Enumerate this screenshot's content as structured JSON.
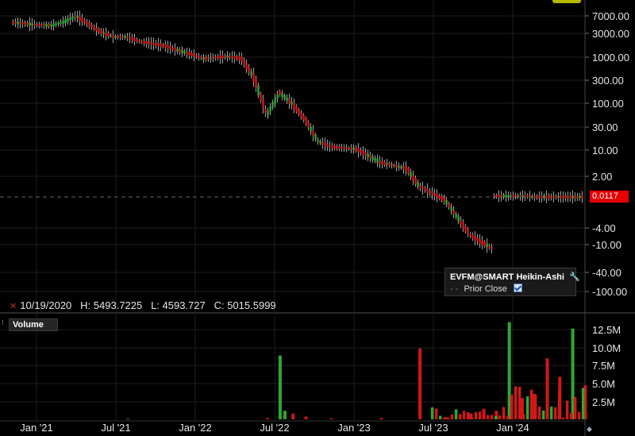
{
  "instrument": {
    "symbol_title": "EVFM@SMART Heikin-Ashi",
    "last_price_badge": "0.0117",
    "wrench_icon": "wrench-icon"
  },
  "legend": {
    "title": "EVFM@SMART Heikin-Ashi",
    "prior_close_label": "Prior Close",
    "prior_close_checked": true
  },
  "ohlc_readout": {
    "date": "10/19/2020",
    "high": "H: 5493.7225",
    "low": "L: 4593.727",
    "close": "C: 5015.5999"
  },
  "volume_panel": {
    "label": "Volume"
  },
  "colors": {
    "up": "#2fa82f",
    "down": "#d01818",
    "background": "#000000",
    "grid": "#1e1e1e",
    "price_badge": "#e60000"
  },
  "chart_data": [
    {
      "type": "candlestick",
      "title": "EVFM@SMART Heikin-Ashi",
      "scale": "log (positive/negative split around 0)",
      "x_ticks": [
        "Jan '21",
        "Jul '21",
        "Jan '22",
        "Jul '22",
        "Jan '23",
        "Jul '23",
        "Jan '24"
      ],
      "y_ticks": [
        "7000.00",
        "3000.00",
        "1000.00",
        "300.00",
        "100.00",
        "30.00",
        "10.00",
        "2.00",
        "-4.00",
        "-10.00",
        "-40.00",
        "-100.00"
      ],
      "last_value": 0.0117,
      "series_points": [
        {
          "x": "2020-10",
          "y": 5000
        },
        {
          "x": "2020-12",
          "y": 4400
        },
        {
          "x": "2021-01",
          "y": 4300
        },
        {
          "x": "2021-02",
          "y": 5200
        },
        {
          "x": "2021-03",
          "y": 7000
        },
        {
          "x": "2021-04",
          "y": 4500
        },
        {
          "x": "2021-05",
          "y": 3000
        },
        {
          "x": "2021-06",
          "y": 2400
        },
        {
          "x": "2021-07",
          "y": 2400
        },
        {
          "x": "2021-08",
          "y": 1900
        },
        {
          "x": "2021-09",
          "y": 1700
        },
        {
          "x": "2021-10",
          "y": 1500
        },
        {
          "x": "2021-11",
          "y": 1200
        },
        {
          "x": "2021-12",
          "y": 1000
        },
        {
          "x": "2022-01",
          "y": 800
        },
        {
          "x": "2022-02",
          "y": 850
        },
        {
          "x": "2022-03",
          "y": 900
        },
        {
          "x": "2022-04",
          "y": 800
        },
        {
          "x": "2022-05",
          "y": 300
        },
        {
          "x": "2022-06",
          "y": 45
        },
        {
          "x": "2022-07",
          "y": 140
        },
        {
          "x": "2022-08",
          "y": 80
        },
        {
          "x": "2022-09",
          "y": 35
        },
        {
          "x": "2022-10",
          "y": 12
        },
        {
          "x": "2022-11",
          "y": 9
        },
        {
          "x": "2023-01",
          "y": 8
        },
        {
          "x": "2023-03",
          "y": 4
        },
        {
          "x": "2023-05",
          "y": 3
        },
        {
          "x": "2023-06",
          "y": 1.2
        },
        {
          "x": "2023-08",
          "y": 0.6
        },
        {
          "x": "2023-10",
          "y": 0.1
        },
        {
          "x": "2024-01",
          "y": 0.03
        },
        {
          "x": "2024-05",
          "y": 0.0117
        }
      ]
    },
    {
      "type": "bar",
      "title": "Volume",
      "y_ticks": [
        "12.5M",
        "10.0M",
        "7.5M",
        "5.0M",
        "2.5M"
      ],
      "ylim": [
        0,
        14000000
      ],
      "bars": [
        {
          "x": "2021-07",
          "value": 80000,
          "dir": "up"
        },
        {
          "x": "2022-06",
          "value": 200000,
          "dir": "down"
        },
        {
          "x": "2022-07",
          "value": 9000000,
          "dir": "up"
        },
        {
          "x": "2022-07b",
          "value": 1200000,
          "dir": "up"
        },
        {
          "x": "2022-08",
          "value": 800000,
          "dir": "down"
        },
        {
          "x": "2022-09",
          "value": 400000,
          "dir": "down"
        },
        {
          "x": "2022-11",
          "value": 150000,
          "dir": "down"
        },
        {
          "x": "2023-03",
          "value": 200000,
          "dir": "down"
        },
        {
          "x": "2023-06",
          "value": 10000000,
          "dir": "down"
        },
        {
          "x": "2023-08",
          "value": 300000,
          "dir": "down"
        },
        {
          "x": "2023-10",
          "value": 800000,
          "dir": "down"
        },
        {
          "x": "2023-11",
          "value": 1500000,
          "dir": "down"
        },
        {
          "x": "2023-12",
          "value": 1200000,
          "dir": "down"
        },
        {
          "x": "2024-01",
          "value": 13700000,
          "dir": "up"
        },
        {
          "x": "2024-02",
          "value": 3000000,
          "dir": "down"
        },
        {
          "x": "2024-03",
          "value": 3600000,
          "dir": "down"
        },
        {
          "x": "2024-04",
          "value": 8600000,
          "dir": "down"
        },
        {
          "x": "2024-05",
          "value": 6000000,
          "dir": "down"
        },
        {
          "x": "2024-06",
          "value": 12800000,
          "dir": "up"
        },
        {
          "x": "2024-07",
          "value": 4800000,
          "dir": "down"
        }
      ]
    }
  ]
}
